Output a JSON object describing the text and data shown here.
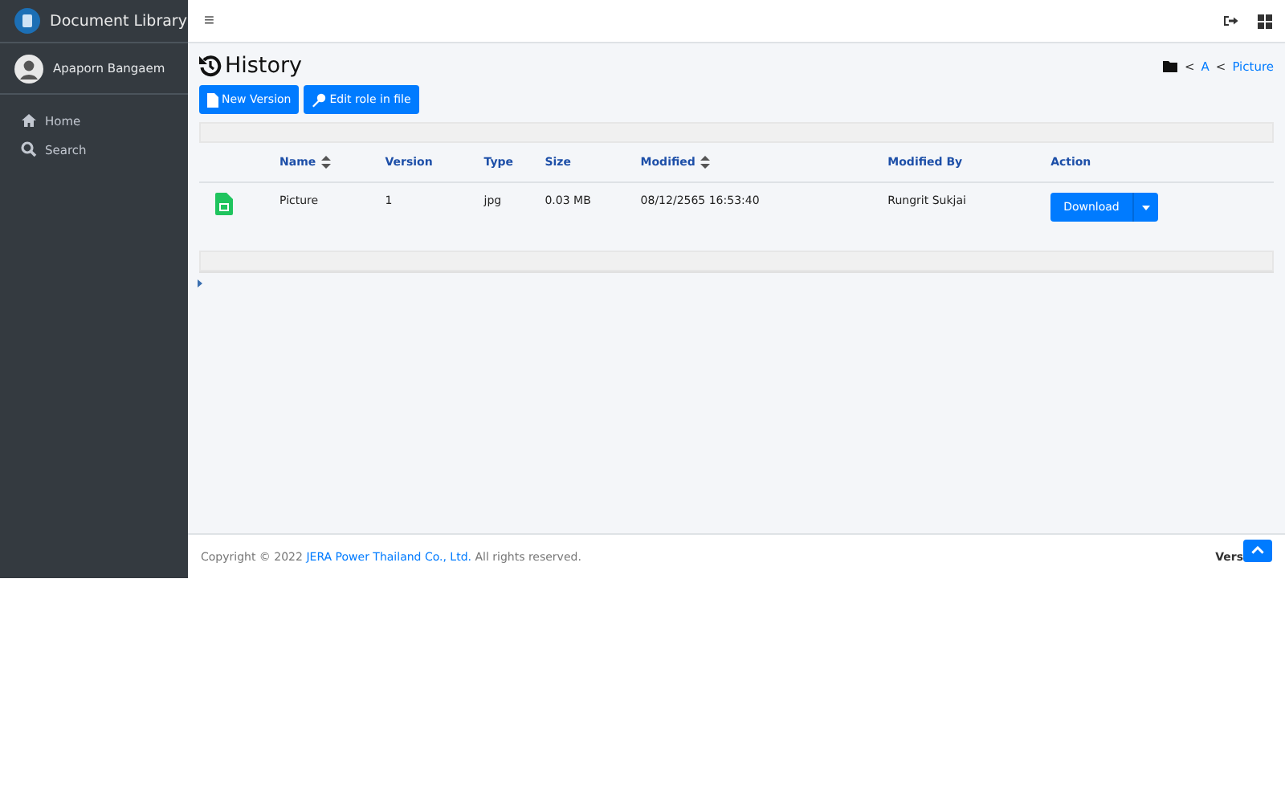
{
  "brand": {
    "title": "Document Library"
  },
  "user": {
    "name": "Apaporn Bangaem"
  },
  "sidebar": {
    "items": [
      {
        "label": "Home"
      },
      {
        "label": "Search"
      }
    ]
  },
  "navbar": {
    "menu_glyph": "≡"
  },
  "page": {
    "title": "History",
    "buttons": [
      {
        "label": "New Version"
      },
      {
        "label": "Edit role in file"
      }
    ]
  },
  "breadcrumb": [
    {
      "label": "<",
      "kind": "sep"
    },
    {
      "label": "A",
      "kind": "link"
    },
    {
      "label": "<",
      "kind": "sep"
    },
    {
      "label": "Picture",
      "kind": "link"
    }
  ],
  "table": {
    "columns": [
      {
        "label": "Name",
        "sortable": true
      },
      {
        "label": "Version",
        "sortable": false
      },
      {
        "label": "Type",
        "sortable": false
      },
      {
        "label": "Size",
        "sortable": false
      },
      {
        "label": "Modified",
        "sortable": true
      },
      {
        "label": "Modified By",
        "sortable": false
      },
      {
        "label": "Action",
        "sortable": false
      }
    ],
    "rows": [
      {
        "name": "Picture",
        "version": "1",
        "type": "jpg",
        "size": "0.03 MB",
        "modified": "08/12/2565 16:53:40",
        "modified_by": "Rungrit Sukjai",
        "action": "Download"
      }
    ]
  },
  "footer": {
    "prefix": "Copyright © 2022",
    "company": "JERA Power Thailand Co., Ltd.",
    "suffix": "All rights reserved.",
    "version": "Vers"
  }
}
